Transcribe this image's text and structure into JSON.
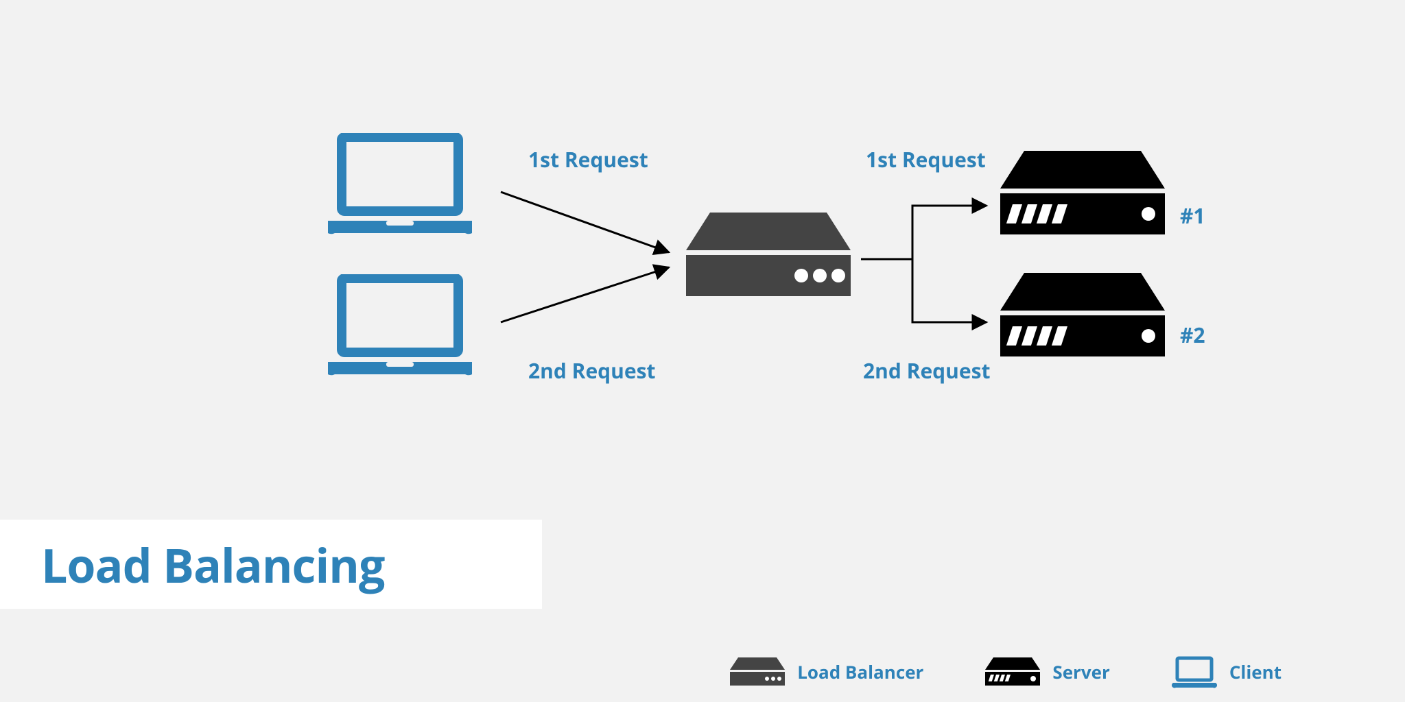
{
  "title": "Load Balancing",
  "labels": {
    "req1_in": "1st Request",
    "req2_in": "2nd Request",
    "req1_out": "1st Request",
    "req2_out": "2nd Request"
  },
  "servers": {
    "s1": "#1",
    "s2": "#2"
  },
  "legend": {
    "lb": "Load Balancer",
    "server": "Server",
    "client": "Client"
  },
  "colors": {
    "accent": "#2e82b8",
    "lb": "#444444",
    "server": "#000000",
    "arrow": "#000000"
  }
}
